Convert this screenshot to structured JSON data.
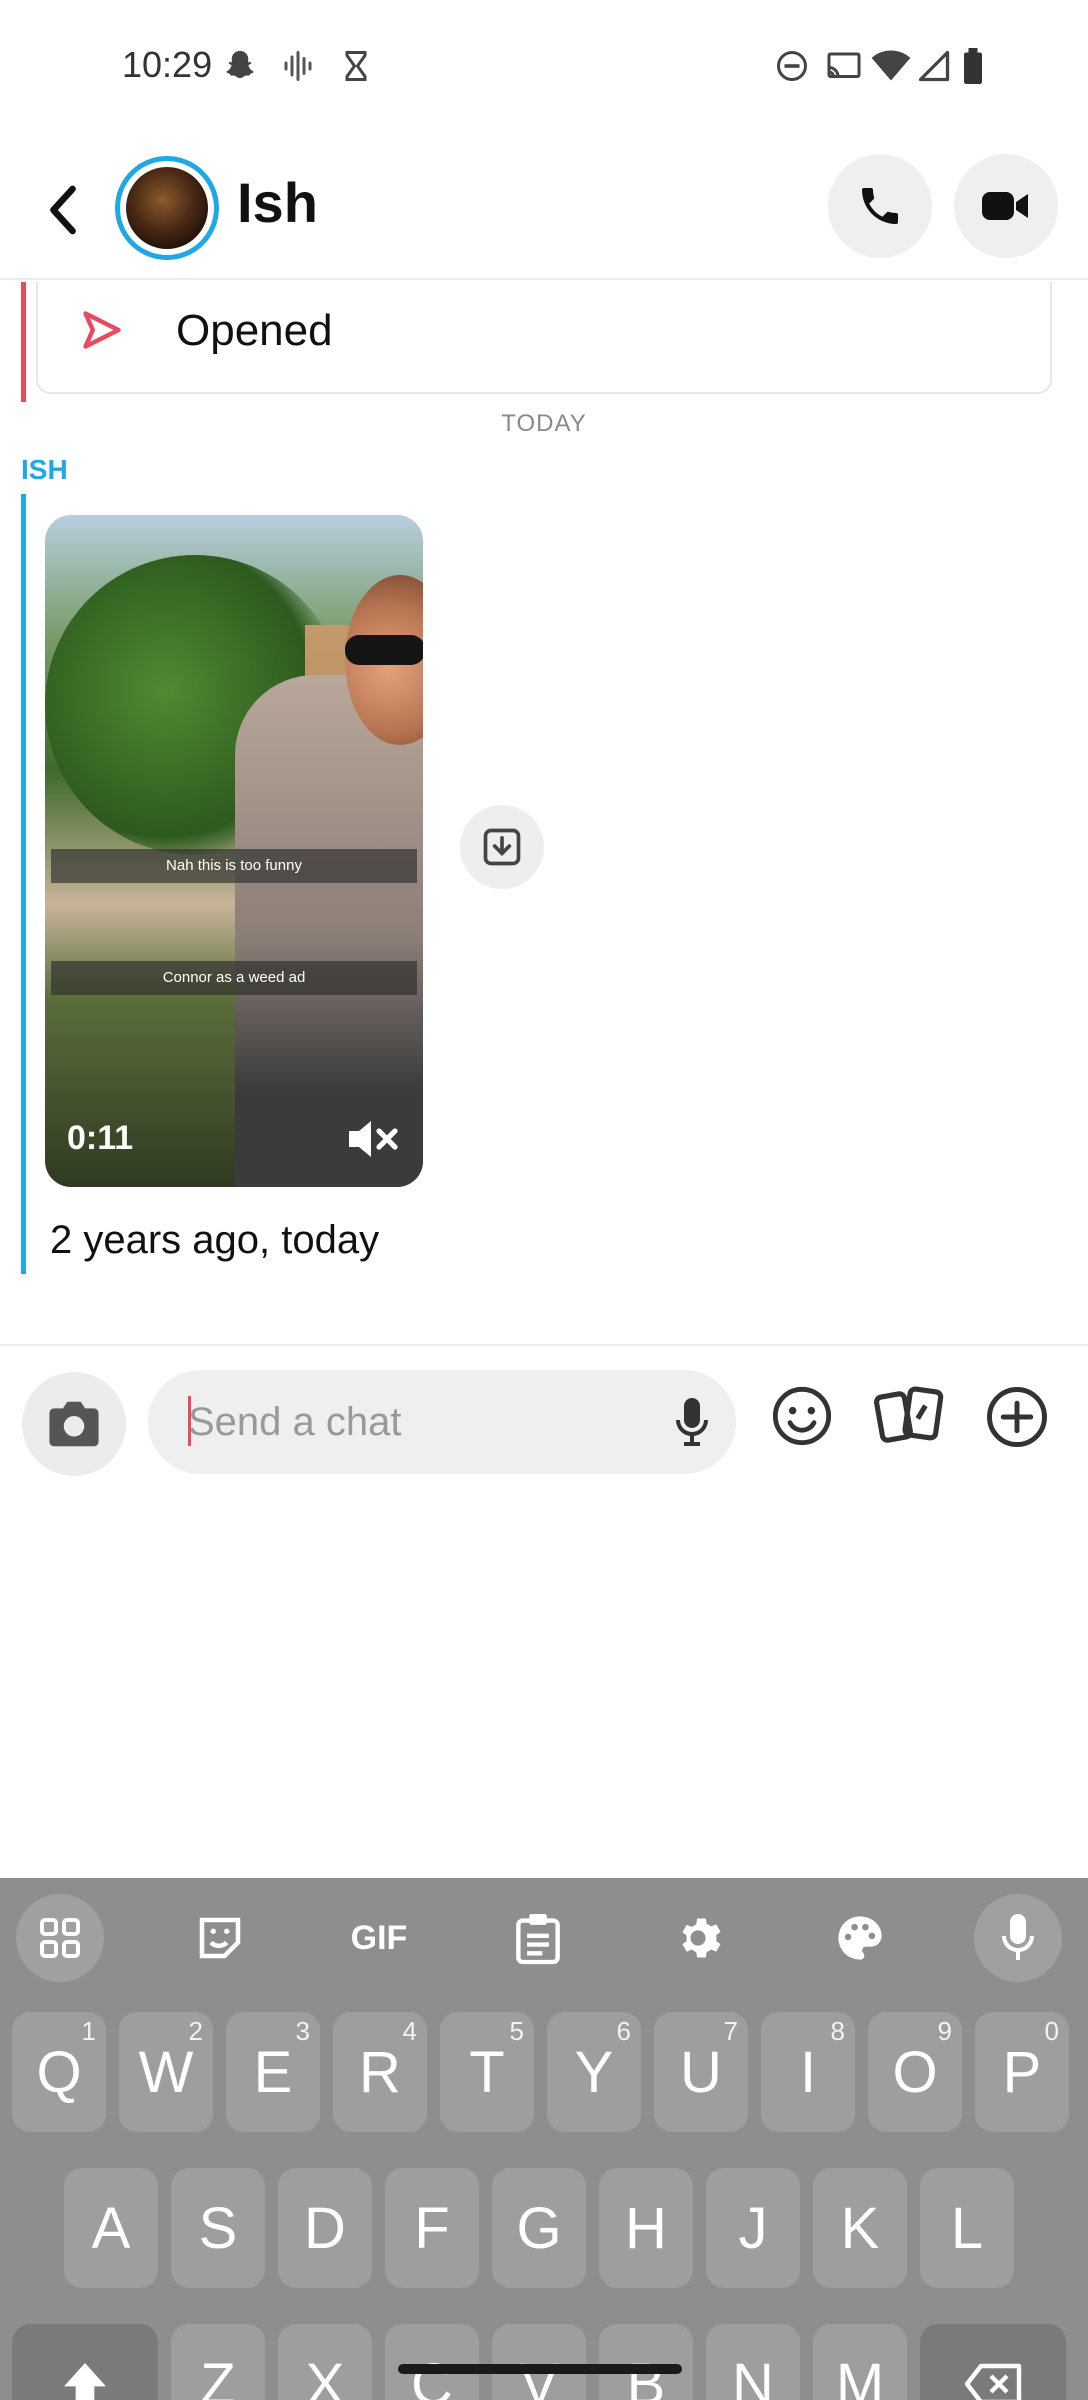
{
  "status_bar": {
    "time": "10:29",
    "left_icons": [
      "snapchat-ghost-icon",
      "voice-wave-icon",
      "hourglass-icon"
    ],
    "right_icons": [
      "do-not-disturb-icon",
      "cast-icon",
      "wifi-icon",
      "cell-signal-icon",
      "battery-icon"
    ]
  },
  "header": {
    "back_icon": "chevron-left-icon",
    "friend_name": "Ish",
    "call_icon": "phone-icon",
    "video_icon": "video-camera-icon"
  },
  "chat": {
    "opened_status": "Opened",
    "date_separator": "TODAY",
    "sender": "ISH",
    "snap": {
      "caption_1": "Nah this is too funny",
      "caption_2": "Connor as a weed ad",
      "duration": "0:11",
      "mute_icon": "muted-speaker-icon"
    },
    "save_icon": "save-to-chat-icon",
    "memory_text": "2 years ago, today"
  },
  "composer": {
    "placeholder": "Send a chat",
    "camera_icon": "camera-icon",
    "mic_icon": "microphone-icon",
    "emoji_icon": "smiley-icon",
    "cards_icon": "cards-icon",
    "plus_icon": "plus-circle-icon"
  },
  "keyboard": {
    "toolbar": [
      "apps-grid-icon",
      "sticker-icon",
      "GIF",
      "clipboard-icon",
      "settings-gear-icon",
      "palette-icon",
      "microphone-icon"
    ],
    "row1": [
      {
        "k": "Q",
        "h": "1"
      },
      {
        "k": "W",
        "h": "2"
      },
      {
        "k": "E",
        "h": "3"
      },
      {
        "k": "R",
        "h": "4"
      },
      {
        "k": "T",
        "h": "5"
      },
      {
        "k": "Y",
        "h": "6"
      },
      {
        "k": "U",
        "h": "7"
      },
      {
        "k": "I",
        "h": "8"
      },
      {
        "k": "O",
        "h": "9"
      },
      {
        "k": "P",
        "h": "0"
      }
    ],
    "row2": [
      "A",
      "S",
      "D",
      "F",
      "G",
      "H",
      "J",
      "K",
      "L"
    ],
    "row3": [
      "Z",
      "X",
      "C",
      "V",
      "B",
      "N",
      "M"
    ]
  },
  "colors": {
    "accent_blue": "#1fa8e6",
    "accent_red": "#e84a5f",
    "keyboard_bg": "#8e8e8e",
    "key_bg": "#9e9e9e"
  }
}
